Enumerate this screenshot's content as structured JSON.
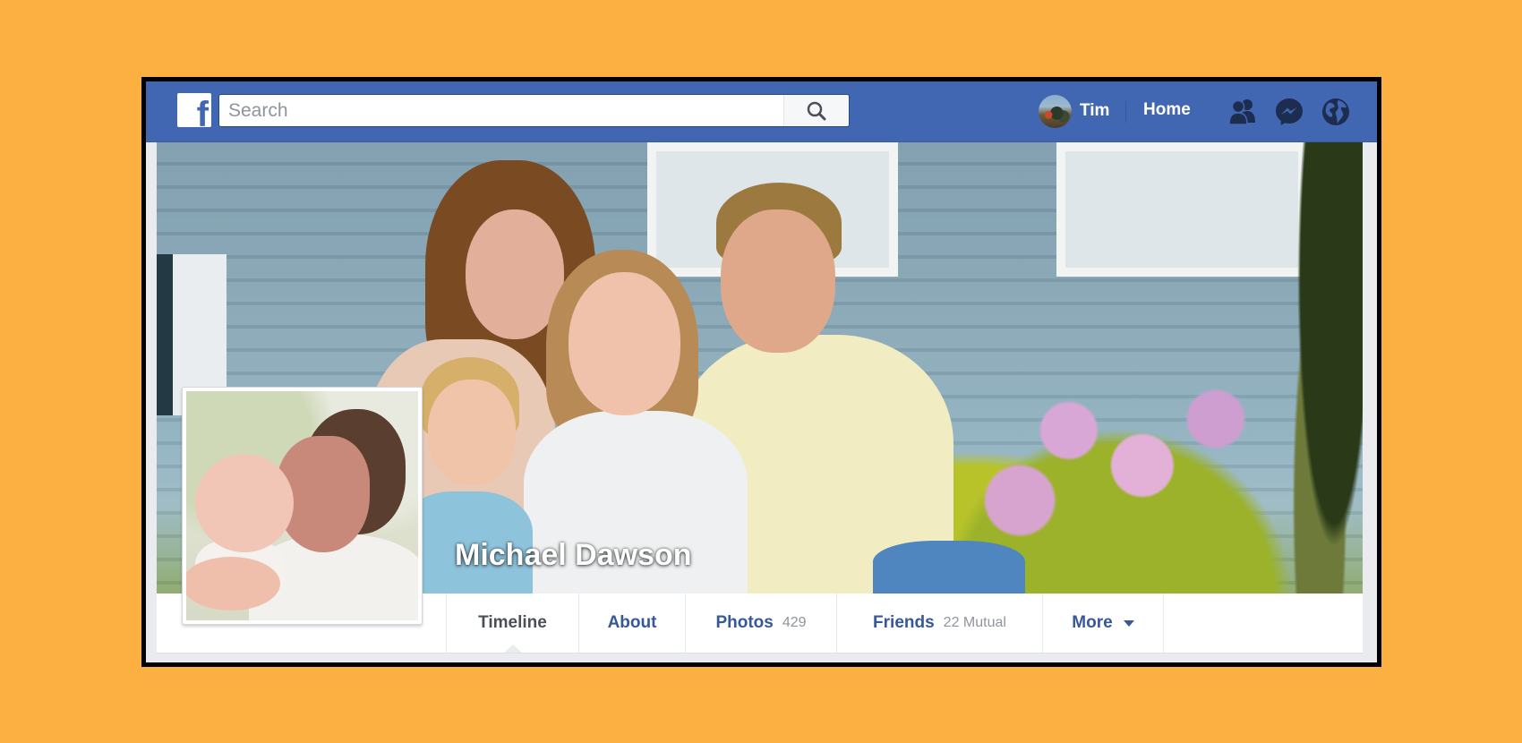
{
  "topbar": {
    "logo_letter": "f",
    "search_placeholder": "Search",
    "search_value": "",
    "user_name": "Tim",
    "home_label": "Home",
    "icons": [
      "friend-requests-icon",
      "messenger-icon",
      "notifications-globe-icon"
    ]
  },
  "profile": {
    "name": "Michael Dawson"
  },
  "tabs": [
    {
      "label": "Timeline",
      "count": "",
      "active": true
    },
    {
      "label": "About",
      "count": ""
    },
    {
      "label": "Photos",
      "count": "429"
    },
    {
      "label": "Friends",
      "count": "22 Mutual"
    },
    {
      "label": "More",
      "count": "",
      "has_dropdown": true
    }
  ],
  "colors": {
    "background": "#fcb042",
    "brand_blue": "#4267b2",
    "link_blue": "#365899",
    "icon_dark": "#1d2d4f"
  }
}
